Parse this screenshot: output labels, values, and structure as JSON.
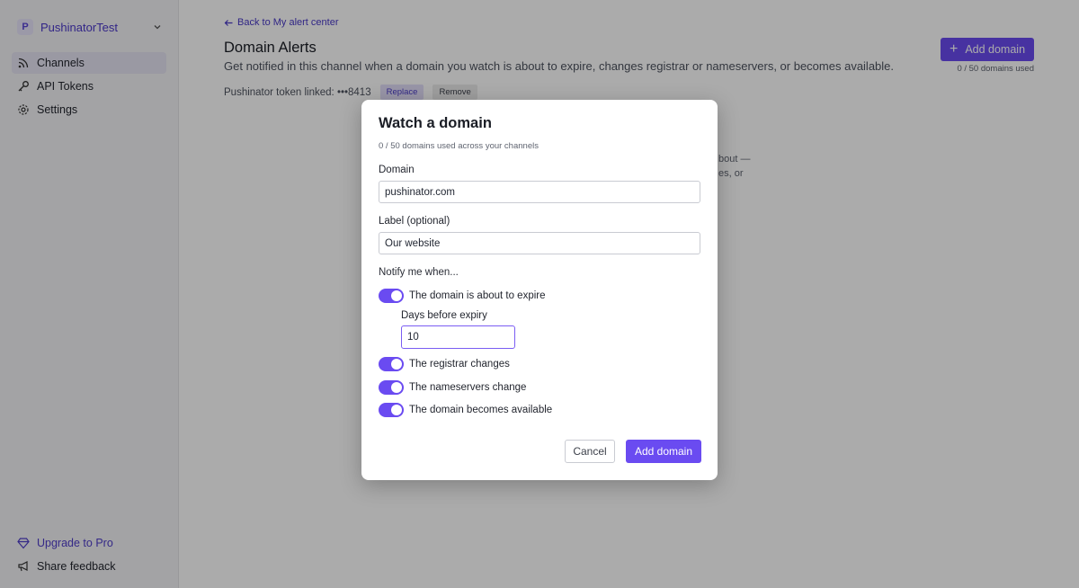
{
  "sidebar": {
    "workspace": {
      "initial": "P",
      "name": "PushinatorTest"
    },
    "nav": [
      {
        "label": "Channels",
        "icon": "rss-icon",
        "active": true
      },
      {
        "label": "API Tokens",
        "icon": "key-icon",
        "active": false
      },
      {
        "label": "Settings",
        "icon": "gear-icon",
        "active": false
      }
    ],
    "bottom": {
      "upgrade": "Upgrade to Pro",
      "feedback": "Share feedback"
    }
  },
  "main": {
    "back_link": "Back to My alert center",
    "title": "Domain Alerts",
    "description": "Get notified in this channel when a domain you watch is about to expire, changes registrar or nameservers, or becomes available.",
    "add_button": "Add domain",
    "usage": "0 / 50 domains used",
    "token_label": "Pushinator token linked: •••8413",
    "replace": "Replace",
    "remove": "Remove",
    "partial_text": [
      "bout —",
      "es, or"
    ]
  },
  "modal": {
    "title": "Watch a domain",
    "subtitle": "0 / 50 domains used across your channels",
    "domain_label": "Domain",
    "domain_value": "pushinator.com",
    "label_label": "Label (optional)",
    "label_value": "Our website",
    "notify_heading": "Notify me when...",
    "toggles": {
      "expire": "The domain is about to expire",
      "registrar": "The registrar changes",
      "nameservers": "The nameservers change",
      "available": "The domain becomes available"
    },
    "days_label": "Days before expiry",
    "days_value": "10",
    "cancel": "Cancel",
    "submit": "Add domain"
  },
  "colors": {
    "accent": "#6a4bf1",
    "accent_text": "#4a37c9",
    "overlay": "rgba(0,0,0,0.33)"
  }
}
